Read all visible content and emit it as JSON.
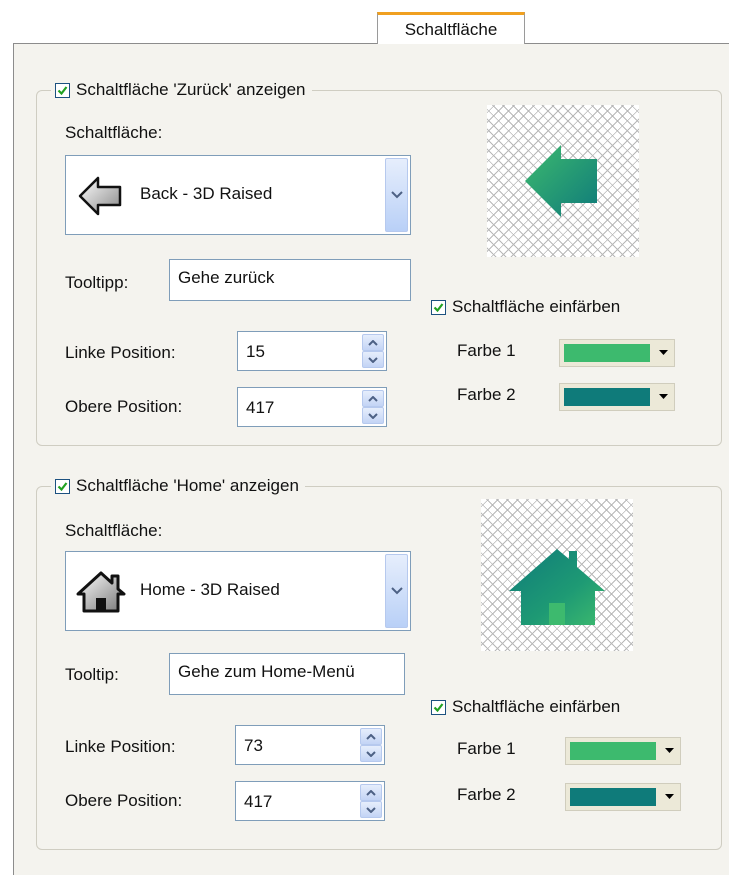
{
  "tab": {
    "label": "Schaltfläche"
  },
  "colors": {
    "farbe1": "#3dba6e",
    "farbe2": "#0f7b7a"
  },
  "back": {
    "show_label": "Schaltfläche 'Zurück' anzeigen",
    "button_label": "Schaltfläche:",
    "combo_value": "Back - 3D Raised",
    "tooltip_label": "Tooltipp:",
    "tooltip_value": "Gehe zurück",
    "left_label": "Linke Position:",
    "left_value": "15",
    "top_label": "Obere Position:",
    "top_value": "417",
    "tint_label": "Schaltfläche einfärben",
    "color1_label": "Farbe 1",
    "color2_label": "Farbe 2"
  },
  "home": {
    "show_label": "Schaltfläche 'Home' anzeigen",
    "button_label": "Schaltfläche:",
    "combo_value": "Home - 3D Raised",
    "tooltip_label": "Tooltip:",
    "tooltip_value": "Gehe zum Home-Menü",
    "left_label": "Linke Position:",
    "left_value": "73",
    "top_label": "Obere Position:",
    "top_value": "417",
    "tint_label": "Schaltfläche einfärben",
    "color1_label": "Farbe 1",
    "color2_label": "Farbe 2"
  }
}
